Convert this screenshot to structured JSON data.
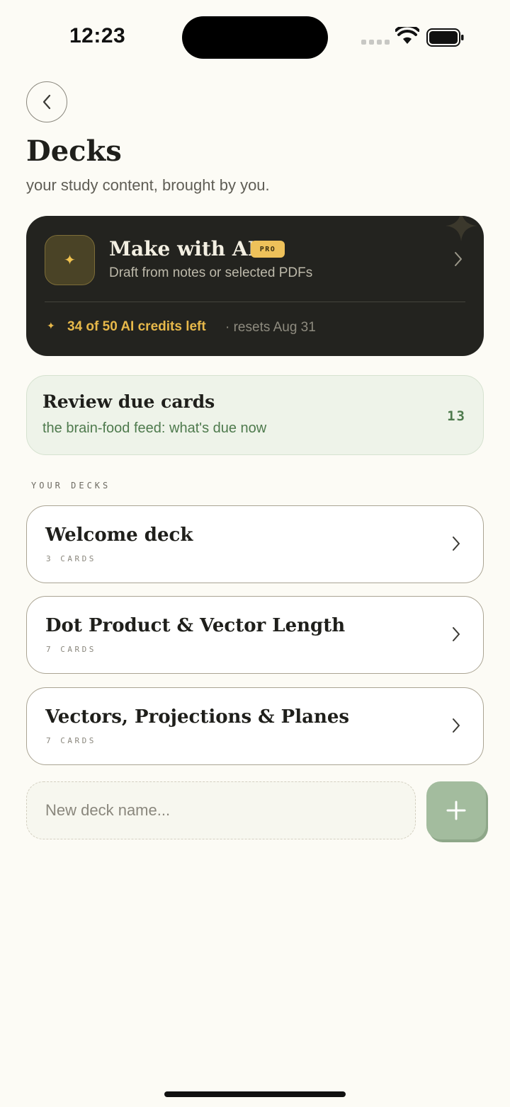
{
  "status_bar": {
    "time": "12:23"
  },
  "header": {
    "back_icon": "chevron-left-icon",
    "title": "Decks",
    "subtitle": "your study content, brought by you."
  },
  "ai_card": {
    "icon": "sparkle-icon",
    "title": "Make with AI",
    "badge": "PRO",
    "subtitle": "Draft from notes or selected PDFs",
    "credits": "34 of 50 AI credits left",
    "resets": "· resets Aug 31"
  },
  "review_card": {
    "title": "Review due cards",
    "subtitle": "the brain-food feed: what's due now",
    "count": "13"
  },
  "decks_section": {
    "label": "YOUR DECKS",
    "items": [
      {
        "name": "Welcome deck",
        "count": "3 CARDS"
      },
      {
        "name": "Dot Product & Vector Length",
        "count": "7 CARDS"
      },
      {
        "name": "Vectors, Projections & Planes",
        "count": "7 CARDS"
      }
    ]
  },
  "new_deck": {
    "placeholder": "New deck name...",
    "add_icon": "plus-icon"
  },
  "colors": {
    "background": "#fcfbf5",
    "ai_card_bg": "#23231f",
    "accent_gold": "#e7b84a",
    "review_green": "#4e7a4d",
    "add_button": "#a3bc9e"
  }
}
